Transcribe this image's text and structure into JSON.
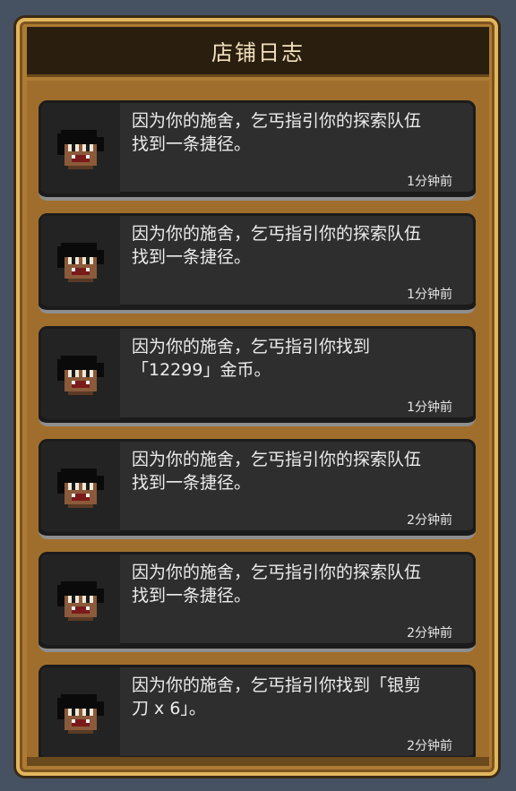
{
  "header": {
    "title": "店铺日志"
  },
  "entries": [
    {
      "text": "因为你的施舍，乞丐指引你的探索队伍\n找到一条捷径。",
      "time": "1分钟前"
    },
    {
      "text": "因为你的施舍，乞丐指引你的探索队伍\n找到一条捷径。",
      "time": "1分钟前"
    },
    {
      "text": "因为你的施舍，乞丐指引你找到\n「12299」金币。",
      "time": "1分钟前"
    },
    {
      "text": "因为你的施舍，乞丐指引你的探索队伍\n找到一条捷径。",
      "time": "2分钟前"
    },
    {
      "text": "因为你的施舍，乞丐指引你的探索队伍\n找到一条捷径。",
      "time": "2分钟前"
    },
    {
      "text": "因为你的施舍，乞丐指引你找到「银剪\n刀 x 6」。",
      "time": "2分钟前"
    }
  ],
  "icons": {
    "portrait": "beggar-portrait-icon"
  },
  "colors": {
    "frame_gold": "#ad7b33",
    "entry_bg": "#2e2e2e",
    "background": "#465262"
  }
}
